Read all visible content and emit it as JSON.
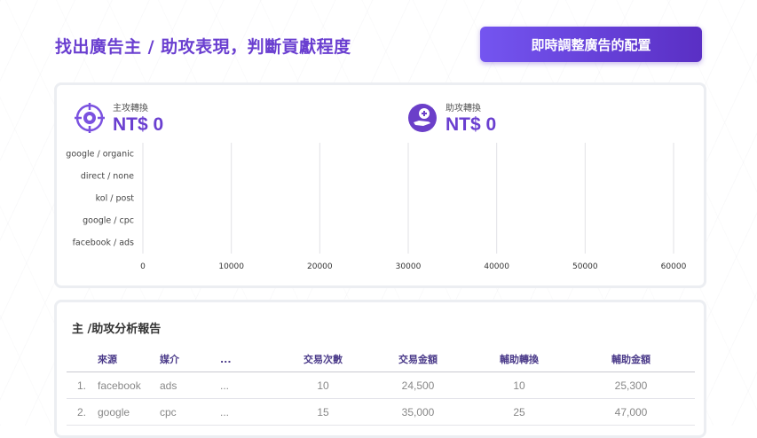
{
  "page": {
    "title": "找出廣告主 / 助攻表現，判斷貢獻程度",
    "cta_label": "即時調整廣告的配置"
  },
  "metrics": [
    {
      "label": "主攻轉換",
      "value": "NT$ 0",
      "icon": "crosshair-target-icon"
    },
    {
      "label": "助攻轉換",
      "value": "NT$ 0",
      "icon": "hand-coin-icon"
    }
  ],
  "colors": {
    "accent": "#6a3fd0",
    "button_start": "#7455f0",
    "button_end": "#5a2fc4"
  },
  "chart_data": {
    "type": "bar",
    "orientation": "horizontal",
    "categories": [
      "google / organic",
      "direct / none",
      "kol / post",
      "google / cpc",
      "facebook / ads"
    ],
    "series": [
      {
        "values": [
          0,
          0,
          0,
          0,
          0
        ]
      }
    ],
    "xlim": [
      0,
      60000
    ],
    "xticks": [
      "0",
      "10000",
      "20000",
      "30000",
      "40000",
      "50000",
      "60000"
    ],
    "grid": true
  },
  "report": {
    "title": "主 /助攻分析報告",
    "columns": [
      "",
      "來源",
      "媒介",
      "...",
      "交易次數",
      "交易金額",
      "輔助轉換",
      "輔助金額"
    ],
    "rows": [
      {
        "rank": "1.",
        "source": "facebook",
        "medium": "ads",
        "more": "...",
        "transactions": "10",
        "amount": "24,500",
        "assists": "10",
        "assist_amount": "25,300"
      },
      {
        "rank": "2.",
        "source": "google",
        "medium": "cpc",
        "more": "...",
        "transactions": "15",
        "amount": "35,000",
        "assists": "25",
        "assist_amount": "47,000"
      }
    ]
  }
}
